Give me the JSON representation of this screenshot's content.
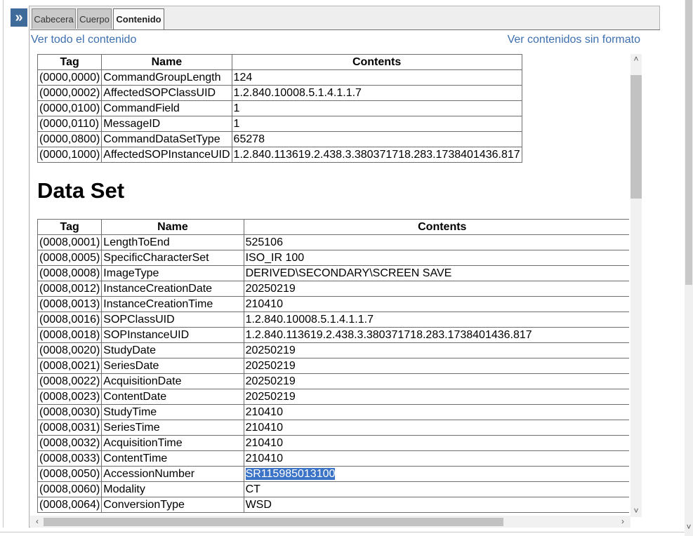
{
  "expand_glyph": "»",
  "tabs": [
    {
      "label": "Cabecera"
    },
    {
      "label": "Cuerpo"
    },
    {
      "label": "Contenido"
    }
  ],
  "links": {
    "view_all": "Ver todo el contenido",
    "view_raw": "Ver contenidos sin formato"
  },
  "command_table": {
    "headers": [
      "Tag",
      "Name",
      "Contents"
    ],
    "rows": [
      [
        "(0000,0000)",
        "CommandGroupLength",
        "124"
      ],
      [
        "(0000,0002)",
        "AffectedSOPClassUID",
        "1.2.840.10008.5.1.4.1.1.7"
      ],
      [
        "(0000,0100)",
        "CommandField",
        "1"
      ],
      [
        "(0000,0110)",
        "MessageID",
        "1"
      ],
      [
        "(0000,0800)",
        "CommandDataSetType",
        "65278"
      ],
      [
        "(0000,1000)",
        "AffectedSOPInstanceUID",
        "1.2.840.113619.2.438.3.380371718.283.1738401436.817"
      ]
    ]
  },
  "dataset": {
    "heading": "Data Set",
    "headers": [
      "Tag",
      "Name",
      "Contents"
    ],
    "rows": [
      [
        "(0008,0001)",
        "LengthToEnd",
        "525106"
      ],
      [
        "(0008,0005)",
        "SpecificCharacterSet",
        "ISO_IR 100"
      ],
      [
        "(0008,0008)",
        "ImageType",
        "DERIVED\\SECONDARY\\SCREEN SAVE"
      ],
      [
        "(0008,0012)",
        "InstanceCreationDate",
        "20250219"
      ],
      [
        "(0008,0013)",
        "InstanceCreationTime",
        "210410"
      ],
      [
        "(0008,0016)",
        "SOPClassUID",
        "1.2.840.10008.5.1.4.1.1.7"
      ],
      [
        "(0008,0018)",
        "SOPInstanceUID",
        "1.2.840.113619.2.438.3.380371718.283.1738401436.817"
      ],
      [
        "(0008,0020)",
        "StudyDate",
        "20250219"
      ],
      [
        "(0008,0021)",
        "SeriesDate",
        "20250219"
      ],
      [
        "(0008,0022)",
        "AcquisitionDate",
        "20250219"
      ],
      [
        "(0008,0023)",
        "ContentDate",
        "20250219"
      ],
      [
        "(0008,0030)",
        "StudyTime",
        "210410"
      ],
      [
        "(0008,0031)",
        "SeriesTime",
        "210410"
      ],
      [
        "(0008,0032)",
        "AcquisitionTime",
        "210410"
      ],
      [
        "(0008,0033)",
        "ContentTime",
        "210410"
      ],
      [
        "(0008,0050)",
        "AccessionNumber",
        "SR115985013100"
      ],
      [
        "(0008,0060)",
        "Modality",
        "CT"
      ],
      [
        "(0008,0064)",
        "ConversionType",
        "WSD"
      ]
    ],
    "selected_value": "SR115985013100"
  },
  "scroll_glyphs": {
    "up": "˄",
    "down": "˅",
    "left": "‹",
    "right": "›",
    "outer_down": "˅"
  }
}
